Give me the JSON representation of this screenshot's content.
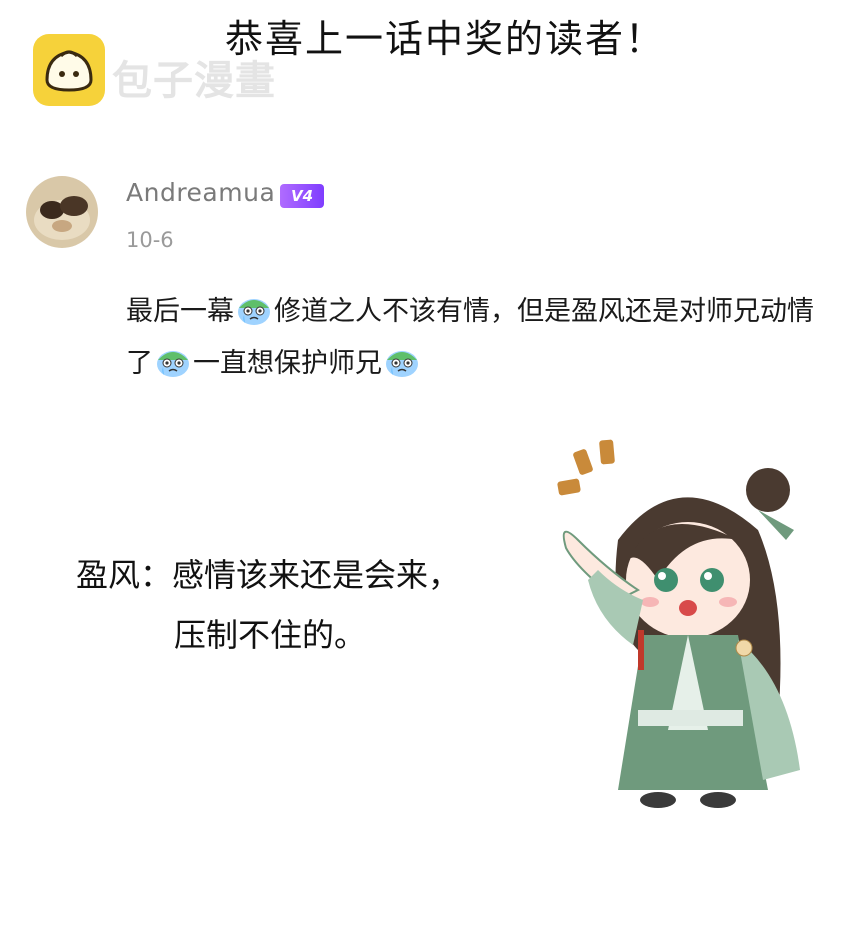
{
  "header": {
    "title": "恭喜上一话中奖的读者！"
  },
  "watermark": {
    "text": "包子漫畫",
    "icon": "bun-logo-icon"
  },
  "comment": {
    "avatar_icon": "cat-avatar-icon",
    "username": "Andreamua",
    "vip_badge": "V4",
    "date": "10-6",
    "text_parts": [
      "最后一幕",
      "修道之人不该有情，但是盈风还是对师兄动情了",
      "一直想保护师兄"
    ],
    "emoji_icon": "crying-face-emoji"
  },
  "caption": {
    "line1": "盈风：感情该来还是会来，",
    "line2": "压制不住的。"
  },
  "illustration": {
    "icon": "chibi-character-illustration"
  },
  "colors": {
    "logo_yellow": "#f6d23a",
    "badge_purple": "#8b4dff",
    "robe_green": "#6f9a7d"
  }
}
